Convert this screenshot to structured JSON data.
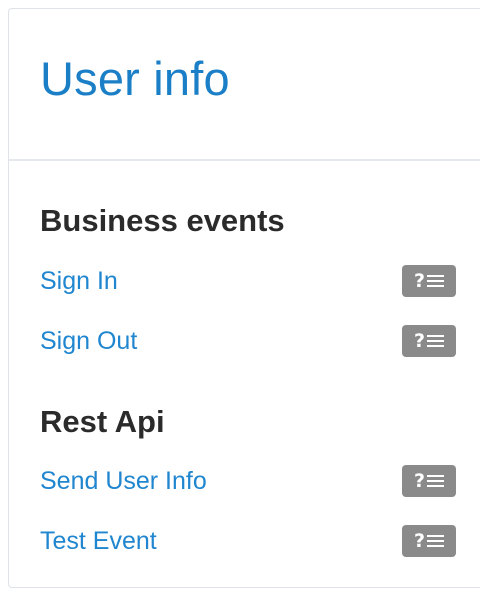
{
  "panel": {
    "title": "User info"
  },
  "sections": [
    {
      "title": "Business events",
      "events": [
        {
          "label": "Sign In",
          "badge_icon": "question-list-icon"
        },
        {
          "label": "Sign Out",
          "badge_icon": "question-list-icon"
        }
      ]
    },
    {
      "title": "Rest Api",
      "events": [
        {
          "label": "Send User Info",
          "badge_icon": "question-list-icon"
        },
        {
          "label": "Test Event",
          "badge_icon": "question-list-icon"
        }
      ]
    }
  ],
  "colors": {
    "title": "#1a7fc7",
    "link": "#1f86cf",
    "heading": "#2b2b2b",
    "badge": "#8a8a8a"
  },
  "badge_glyph": "?"
}
